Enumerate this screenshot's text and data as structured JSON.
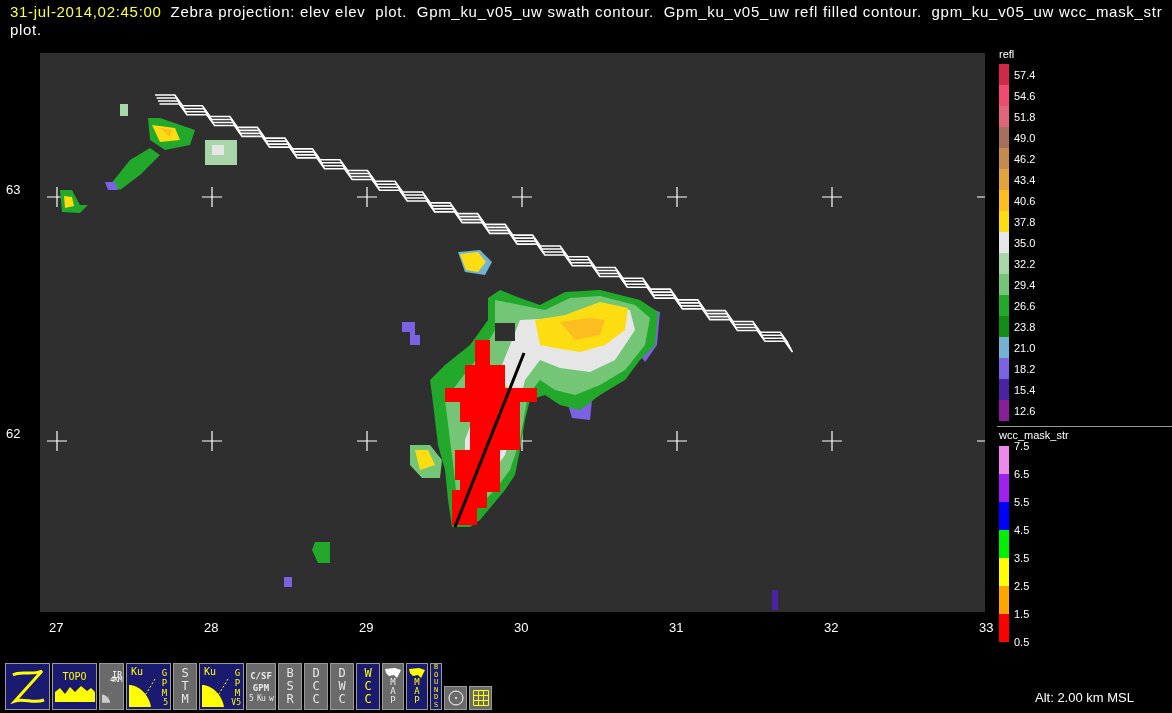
{
  "header": {
    "timestamp": "31-jul-2014,02:45:00",
    "description": "Zebra projection: elev elev  plot.  Gpm_ku_v05_uw swath contour.  Gpm_ku_v05_uw refl filled contour.  gpm_ku_v05_uw wcc_mask_str plot."
  },
  "plot": {
    "y_labels": [
      "63",
      "62"
    ],
    "x_labels": [
      "27",
      "28",
      "29",
      "30",
      "31",
      "32",
      "33"
    ]
  },
  "legends": [
    {
      "kind": "levels",
      "title": "refl",
      "levels": [
        {
          "label": "57.4",
          "color": "#d02848"
        },
        {
          "label": "54.6",
          "color": "#ee4a72"
        },
        {
          "label": "51.8",
          "color": "#e0657c"
        },
        {
          "label": "49.0",
          "color": "#a4705c"
        },
        {
          "label": "46.2",
          "color": "#c48a4e"
        },
        {
          "label": "43.4",
          "color": "#e2a53c"
        },
        {
          "label": "40.6",
          "color": "#fbbd20"
        },
        {
          "label": "37.8",
          "color": "#fcdd12"
        },
        {
          "label": "35.0",
          "color": "#e6e6e6"
        },
        {
          "label": "32.2",
          "color": "#a8d6a8"
        },
        {
          "label": "29.4",
          "color": "#74c676"
        },
        {
          "label": "26.6",
          "color": "#22a82a"
        },
        {
          "label": "23.8",
          "color": "#128c14"
        },
        {
          "label": "21.0",
          "color": "#72b2d2"
        },
        {
          "label": "18.2",
          "color": "#7a62e2"
        },
        {
          "label": "15.4",
          "color": "#4a22a4"
        },
        {
          "label": "12.6",
          "color": "#861e96"
        }
      ]
    },
    {
      "kind": "bins",
      "title": "wcc_mask_str",
      "bins": [
        {
          "color": "#ee88ee"
        },
        {
          "color": "#a020f0"
        },
        {
          "color": "#0000ff"
        },
        {
          "color": "#00ee00"
        },
        {
          "color": "#ffff00"
        },
        {
          "color": "#ffa500"
        },
        {
          "color": "#ff0000"
        }
      ],
      "ticks": [
        "7.5",
        "6.5",
        "5.5",
        "4.5",
        "3.5",
        "2.5",
        "1.5",
        "0.5"
      ]
    }
  ],
  "toolbar": [
    {
      "kind": "logo",
      "on": true
    },
    {
      "kind": "topo",
      "label": "TOPO",
      "on": true
    },
    {
      "kind": "ir",
      "label": "IR",
      "sub": "4KM",
      "on": false
    },
    {
      "kind": "gpm",
      "label": "Ku",
      "side": "GPM",
      "sub": "5",
      "on": true
    },
    {
      "kind": "stack",
      "label": "STM",
      "on": false
    },
    {
      "kind": "gpm",
      "label": "Ku",
      "side": "GPM",
      "sub": "V5",
      "on": true
    },
    {
      "kind": "csf",
      "label": "C/SF",
      "side": "GPM",
      "sub": "5 Ku w",
      "on": false
    },
    {
      "kind": "stack",
      "label": "BSR",
      "on": false
    },
    {
      "kind": "stack",
      "label": "DCC",
      "on": false
    },
    {
      "kind": "stack",
      "label": "DWC",
      "on": false
    },
    {
      "kind": "stack",
      "label": "WCC",
      "on": true
    },
    {
      "kind": "map",
      "label": "MAP",
      "on": false
    },
    {
      "kind": "map",
      "label": "MAP",
      "on": true
    },
    {
      "kind": "bounds",
      "label": "BOUNDS",
      "on": true
    },
    {
      "kind": "circle",
      "on": false
    },
    {
      "kind": "grid",
      "on": false
    }
  ],
  "status": "Alt: 2.00 km MSL"
}
